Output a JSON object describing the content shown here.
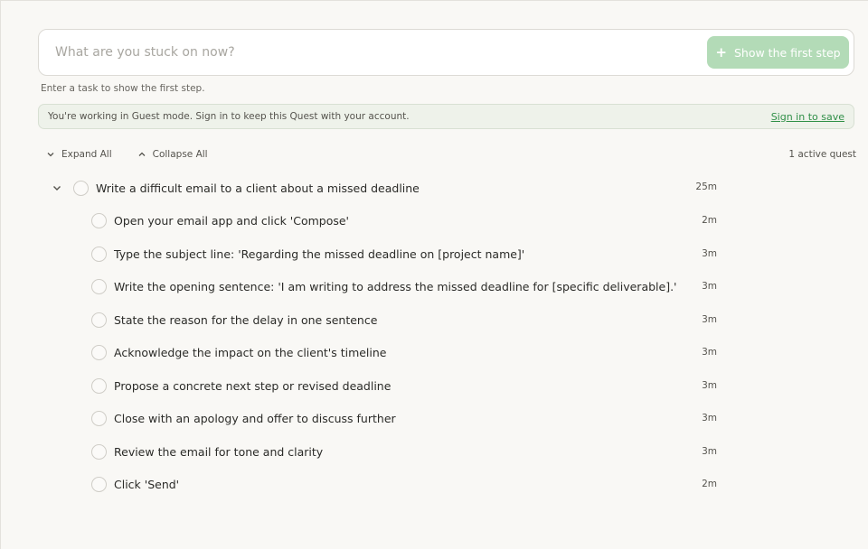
{
  "search": {
    "placeholder": "What are you stuck on now?",
    "value": "",
    "button_label": "Show the first step"
  },
  "hint_text": "Enter a task to show the first step.",
  "guest_banner": {
    "message": "You're working in Guest mode. Sign in to keep this Quest with your account.",
    "link_label": "Sign in to save"
  },
  "controls": {
    "expand_label": "Expand All",
    "collapse_label": "Collapse All",
    "active_count": "1 active quest"
  },
  "quest": {
    "title": "Write a difficult email to a client about a missed deadline",
    "duration": "25m",
    "steps": [
      {
        "label": "Open your email app and click 'Compose'",
        "duration": "2m"
      },
      {
        "label": "Type the subject line: 'Regarding the missed deadline on [project name]'",
        "duration": "3m"
      },
      {
        "label": "Write the opening sentence: 'I am writing to address the missed deadline for [specific deliverable].'",
        "duration": "3m"
      },
      {
        "label": "State the reason for the delay in one sentence",
        "duration": "3m"
      },
      {
        "label": "Acknowledge the impact on the client's timeline",
        "duration": "3m"
      },
      {
        "label": "Propose a concrete next step or revised deadline",
        "duration": "3m"
      },
      {
        "label": "Close with an apology and offer to discuss further",
        "duration": "3m"
      },
      {
        "label": "Review the email for tone and clarity",
        "duration": "3m"
      },
      {
        "label": "Click 'Send'",
        "duration": "2m"
      }
    ]
  },
  "colors": {
    "accent": "#2f8f47",
    "button_bg": "#b3dbb7",
    "banner_bg": "#eef2ea"
  }
}
